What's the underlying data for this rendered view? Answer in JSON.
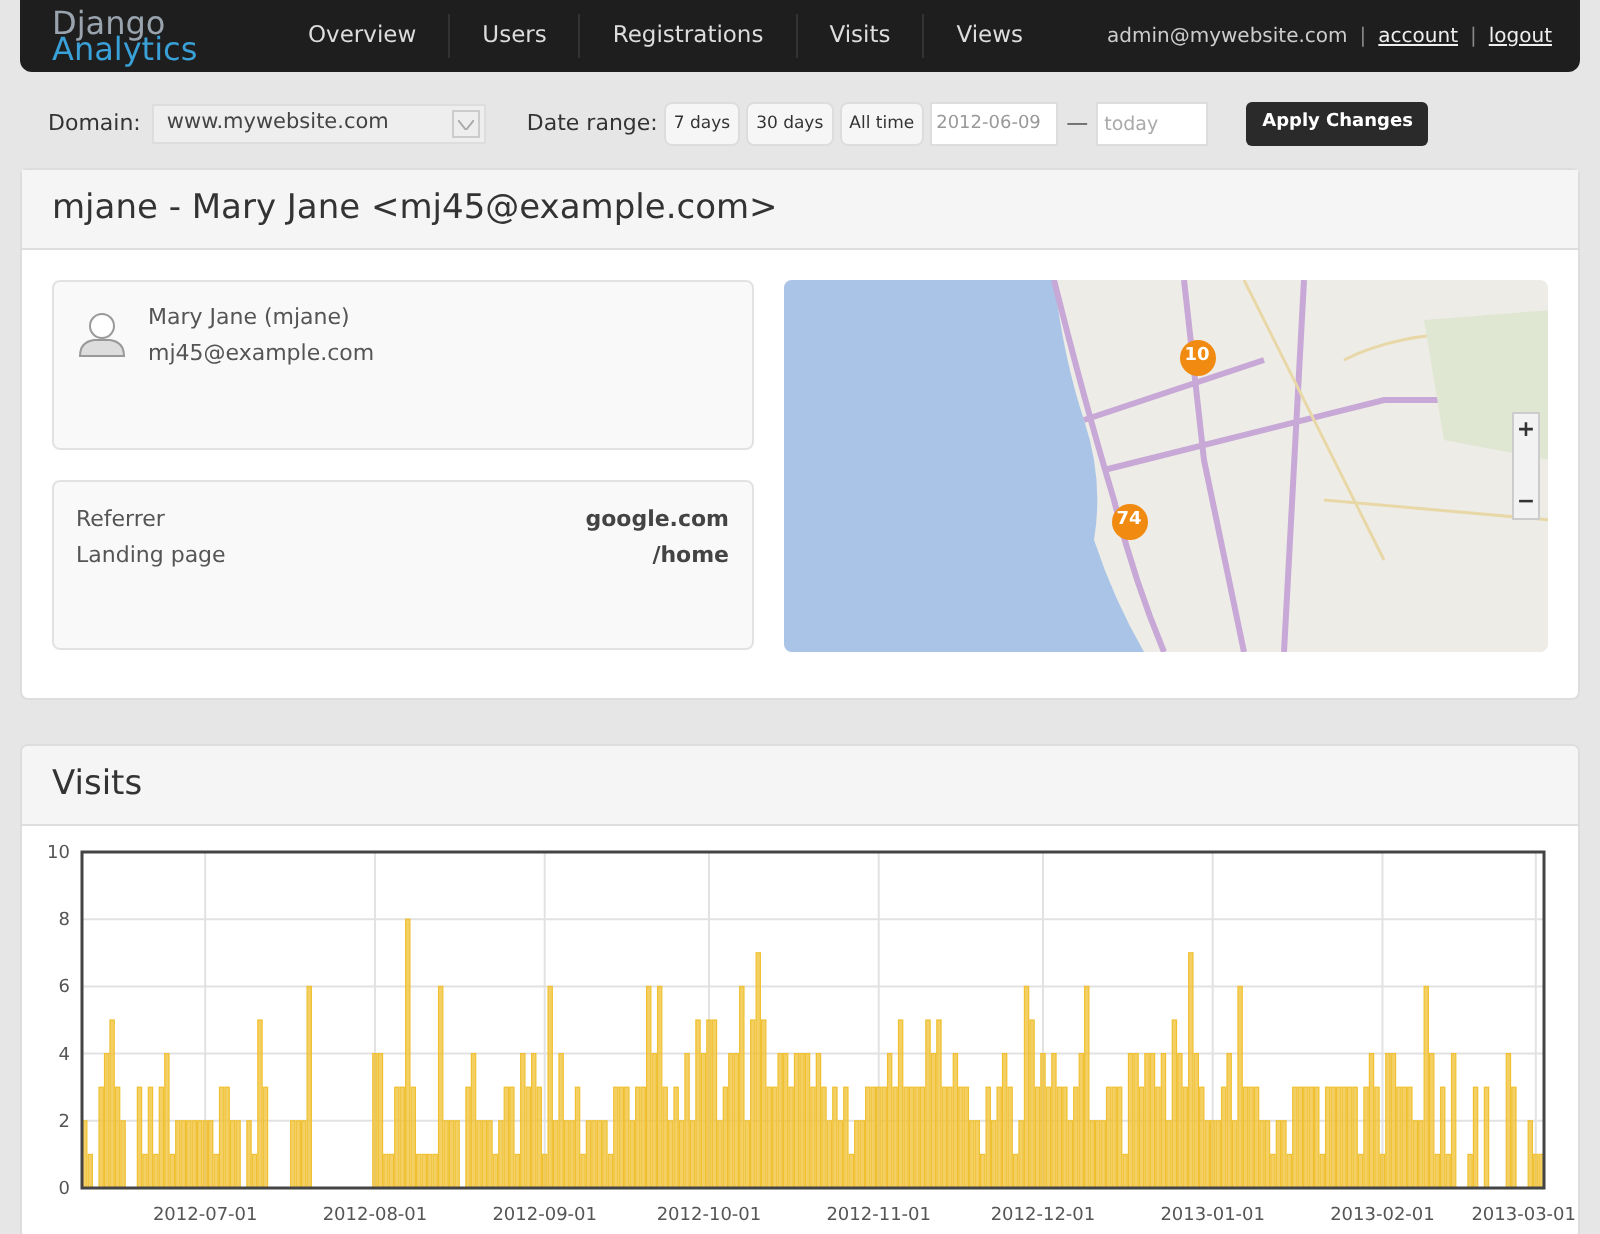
{
  "nav": {
    "logo": [
      "Django",
      "Analytics"
    ],
    "items": [
      "Overview",
      "Users",
      "Registrations",
      "Visits",
      "Views"
    ],
    "user": "admin@mywebsite.com",
    "separators": [
      "|",
      "|"
    ],
    "links": [
      "account",
      "logout"
    ]
  },
  "filters": {
    "domain_label": "Domain:",
    "domain": "www.mywebsite.com",
    "date_range_label": "Date range:",
    "range_buttons": [
      "7 days",
      "30 days",
      "All time"
    ],
    "from": "2012-06-09",
    "separator": "—",
    "to_placeholder": "today",
    "apply": "Apply Changes"
  },
  "profile": {
    "title": "mjane - Mary Jane <mj45@example.com>",
    "name": "Mary Jane (mjane)",
    "email": "mj45@example.com",
    "details": [
      {
        "label": "Referrer",
        "value": "google.com"
      },
      {
        "label": "Landing page",
        "value": "/home"
      }
    ],
    "map": {
      "markers": [
        "10",
        "74"
      ],
      "zoom_in": "+",
      "zoom_out": "−"
    }
  },
  "visits": {
    "title": "Visits",
    "chart_data": {
      "type": "bar",
      "grid": true,
      "ylim": [
        0,
        10
      ],
      "yticks": [
        0,
        2,
        4,
        6,
        8,
        10
      ],
      "xlim": [
        "2012-06-09",
        "2013-03-02"
      ],
      "xticks": [
        "2012-07-01",
        "2012-08-01",
        "2012-09-01",
        "2012-10-01",
        "2012-11-01",
        "2012-12-01",
        "2013-01-01",
        "2013-02-01",
        "2013-03-01"
      ],
      "x": [
        "2012-06-09",
        "2012-06-10",
        "2012-06-11",
        "2012-06-12",
        "2012-06-13",
        "2012-06-14",
        "2012-06-15",
        "2012-06-16",
        "2012-06-17",
        "2012-06-18",
        "2012-06-19",
        "2012-06-20",
        "2012-06-21",
        "2012-06-22",
        "2012-06-23",
        "2012-06-24",
        "2012-06-25",
        "2012-06-26",
        "2012-06-27",
        "2012-06-28",
        "2012-06-29",
        "2012-06-30",
        "2012-07-01",
        "2012-07-02",
        "2012-07-03",
        "2012-07-04",
        "2012-07-05",
        "2012-07-06",
        "2012-07-07",
        "2012-07-08",
        "2012-07-09",
        "2012-07-10",
        "2012-07-11",
        "2012-07-12",
        "2012-07-13",
        "2012-07-14",
        "2012-07-15",
        "2012-07-16",
        "2012-07-17",
        "2012-07-18",
        "2012-07-19",
        "2012-07-20",
        "2012-07-21",
        "2012-07-22",
        "2012-07-23",
        "2012-07-24",
        "2012-07-25",
        "2012-07-26",
        "2012-07-27",
        "2012-07-28",
        "2012-07-29",
        "2012-07-30",
        "2012-07-31",
        "2012-08-01",
        "2012-08-02",
        "2012-08-03",
        "2012-08-04",
        "2012-08-05",
        "2012-08-06",
        "2012-08-07",
        "2012-08-08",
        "2012-08-09",
        "2012-08-10",
        "2012-08-11",
        "2012-08-12",
        "2012-08-13",
        "2012-08-14",
        "2012-08-15",
        "2012-08-16",
        "2012-08-17",
        "2012-08-18",
        "2012-08-19",
        "2012-08-20",
        "2012-08-21",
        "2012-08-22",
        "2012-08-23",
        "2012-08-24",
        "2012-08-25",
        "2012-08-26",
        "2012-08-27",
        "2012-08-28",
        "2012-08-29",
        "2012-08-30",
        "2012-08-31",
        "2012-09-01",
        "2012-09-02",
        "2012-09-03",
        "2012-09-04",
        "2012-09-05",
        "2012-09-06",
        "2012-09-07",
        "2012-09-08",
        "2012-09-09",
        "2012-09-10",
        "2012-09-11",
        "2012-09-12",
        "2012-09-13",
        "2012-09-14",
        "2012-09-15",
        "2012-09-16",
        "2012-09-17",
        "2012-09-18",
        "2012-09-19",
        "2012-09-20",
        "2012-09-21",
        "2012-09-22",
        "2012-09-23",
        "2012-09-24",
        "2012-09-25",
        "2012-09-26",
        "2012-09-27",
        "2012-09-28",
        "2012-09-29",
        "2012-09-30",
        "2012-10-01",
        "2012-10-02",
        "2012-10-03",
        "2012-10-04",
        "2012-10-05",
        "2012-10-06",
        "2012-10-07",
        "2012-10-08",
        "2012-10-09",
        "2012-10-10",
        "2012-10-11",
        "2012-10-12",
        "2012-10-13",
        "2012-10-14",
        "2012-10-15",
        "2012-10-16",
        "2012-10-17",
        "2012-10-18",
        "2012-10-19",
        "2012-10-20",
        "2012-10-21",
        "2012-10-22",
        "2012-10-23",
        "2012-10-24",
        "2012-10-25",
        "2012-10-26",
        "2012-10-27",
        "2012-10-28",
        "2012-10-29",
        "2012-10-30",
        "2012-10-31",
        "2012-11-01",
        "2012-11-02",
        "2012-11-03",
        "2012-11-04",
        "2012-11-05",
        "2012-11-06",
        "2012-11-07",
        "2012-11-08",
        "2012-11-09",
        "2012-11-10",
        "2012-11-11",
        "2012-11-12",
        "2012-11-13",
        "2012-11-14",
        "2012-11-15",
        "2012-11-16",
        "2012-11-17",
        "2012-11-18",
        "2012-11-19",
        "2012-11-20",
        "2012-11-21",
        "2012-11-22",
        "2012-11-23",
        "2012-11-24",
        "2012-11-25",
        "2012-11-26",
        "2012-11-27",
        "2012-11-28",
        "2012-11-29",
        "2012-11-30",
        "2012-12-01",
        "2012-12-02",
        "2012-12-03",
        "2012-12-04",
        "2012-12-05",
        "2012-12-06",
        "2012-12-07",
        "2012-12-08",
        "2012-12-09",
        "2012-12-10",
        "2012-12-11",
        "2012-12-12",
        "2012-12-13",
        "2012-12-14",
        "2012-12-15",
        "2012-12-16",
        "2012-12-17",
        "2012-12-18",
        "2012-12-19",
        "2012-12-20",
        "2012-12-21",
        "2012-12-22",
        "2012-12-23",
        "2012-12-24",
        "2012-12-25",
        "2012-12-26",
        "2012-12-27",
        "2012-12-28",
        "2012-12-29",
        "2012-12-30",
        "2012-12-31",
        "2013-01-01",
        "2013-01-02",
        "2013-01-03",
        "2013-01-04",
        "2013-01-05",
        "2013-01-06",
        "2013-01-07",
        "2013-01-08",
        "2013-01-09",
        "2013-01-10",
        "2013-01-11",
        "2013-01-12",
        "2013-01-13",
        "2013-01-14",
        "2013-01-15",
        "2013-01-16",
        "2013-01-17",
        "2013-01-18",
        "2013-01-19",
        "2013-01-20",
        "2013-01-21",
        "2013-01-22",
        "2013-01-23",
        "2013-01-24",
        "2013-01-25",
        "2013-01-26",
        "2013-01-27",
        "2013-01-28",
        "2013-01-29",
        "2013-01-30",
        "2013-01-31",
        "2013-02-01",
        "2013-02-02",
        "2013-02-03",
        "2013-02-04",
        "2013-02-05",
        "2013-02-06",
        "2013-02-07",
        "2013-02-08",
        "2013-02-09",
        "2013-02-10",
        "2013-02-11",
        "2013-02-12",
        "2013-02-13",
        "2013-02-14",
        "2013-02-15",
        "2013-02-16",
        "2013-02-17",
        "2013-02-18",
        "2013-02-19",
        "2013-02-20",
        "2013-02-21",
        "2013-02-22",
        "2013-02-23",
        "2013-02-24",
        "2013-02-25",
        "2013-02-26",
        "2013-02-27",
        "2013-02-28",
        "2013-03-01",
        "2013-03-02"
      ],
      "series": [
        {
          "color": "#f0c030",
          "values": [
            2,
            1,
            0,
            3,
            4,
            5,
            3,
            2,
            0,
            0,
            3,
            1,
            3,
            1,
            3,
            4,
            1,
            2,
            2,
            2,
            2,
            2,
            2,
            2,
            1,
            3,
            3,
            2,
            2,
            0,
            2,
            1,
            5,
            3,
            0,
            0,
            0,
            0,
            2,
            2,
            2,
            6,
            0,
            0,
            0,
            0,
            0,
            0,
            0,
            0,
            0,
            0,
            0,
            4,
            4,
            1,
            1,
            3,
            3,
            8,
            3,
            1,
            1,
            1,
            1,
            6,
            2,
            2,
            2,
            0,
            3,
            4,
            2,
            2,
            2,
            1,
            2,
            3,
            3,
            1,
            4,
            3,
            4,
            3,
            1,
            6,
            2,
            4,
            2,
            2,
            3,
            1,
            2,
            2,
            2,
            2,
            1,
            3,
            3,
            3,
            2,
            3,
            3,
            6,
            4,
            6,
            3,
            2,
            3,
            2,
            4,
            2,
            5,
            4,
            5,
            5,
            2,
            3,
            4,
            4,
            6,
            2,
            5,
            7,
            5,
            3,
            3,
            4,
            4,
            3,
            4,
            4,
            4,
            3,
            4,
            3,
            2,
            3,
            2,
            3,
            1,
            2,
            2,
            3,
            3,
            3,
            3,
            4,
            3,
            5,
            3,
            3,
            3,
            3,
            5,
            4,
            5,
            3,
            3,
            4,
            3,
            3,
            2,
            2,
            1,
            3,
            2,
            3,
            4,
            3,
            1,
            2,
            6,
            5,
            3,
            4,
            3,
            4,
            3,
            3,
            2,
            3,
            4,
            6,
            2,
            2,
            2,
            3,
            3,
            3,
            1,
            4,
            4,
            3,
            4,
            4,
            3,
            4,
            2,
            5,
            4,
            3,
            7,
            4,
            3,
            2,
            2,
            2,
            3,
            4,
            2,
            6,
            3,
            3,
            3,
            2,
            2,
            1,
            2,
            2,
            1,
            3,
            3,
            3,
            3,
            3,
            1,
            3,
            3,
            3,
            3,
            3,
            3,
            1,
            3,
            4,
            3,
            1,
            4,
            4,
            3,
            3,
            3,
            2,
            2,
            6,
            4,
            1,
            3,
            1,
            4,
            0,
            0,
            1,
            3,
            0,
            3,
            0,
            0,
            0,
            4,
            3,
            0,
            0,
            2,
            1,
            1
          ]
        }
      ]
    }
  }
}
